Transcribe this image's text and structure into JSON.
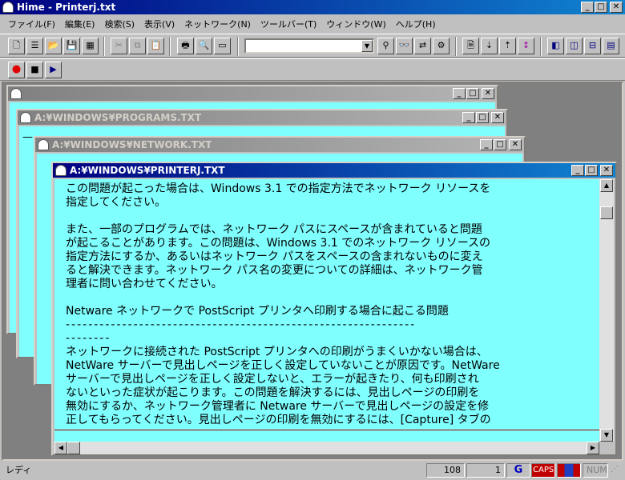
{
  "app": {
    "title": "Hime - Printerj.txt"
  },
  "menu": [
    "ファイル(F)",
    "編集(E)",
    "検索(S)",
    "表示(V)",
    "ネットワーク(N)",
    "ツールバー(T)",
    "ウィンドウ(W)",
    "ヘルプ(H)"
  ],
  "toolbar": {
    "new": "🗋",
    "open_list": "☰",
    "open": "📂",
    "save": "💾",
    "save_all": "▦",
    "cut": "✂",
    "copy": "⧉",
    "paste": "📋",
    "print": "🖶",
    "preview": "🔍",
    "page_setup": "▭",
    "search_value": "",
    "dropdown_arrow": "▼",
    "find": "⚲",
    "find_next": "👓",
    "replace": "⇄",
    "replace_all": "⚙",
    "doc1": "🗎",
    "doc2": "⇣",
    "doc3": "⇡",
    "doc4": "↕",
    "cascade": "◧",
    "tile_v": "◫",
    "tile_h": "⊟",
    "arrange": "▤"
  },
  "macro": {
    "record": "●",
    "stop": "■",
    "play": "▶"
  },
  "windows": {
    "back": {
      "title": ""
    },
    "programs": {
      "title": "A:¥WINDOWS¥PROGRAMS.TXT"
    },
    "network": {
      "title": "A:¥WINDOWS¥NETWORK.TXT"
    },
    "printer": {
      "title": "A:¥WINDOWS¥PRINTERJ.TXT"
    }
  },
  "win_buttons": {
    "minimize": "_",
    "maximize": "□",
    "close": "✕"
  },
  "document": {
    "lines": [
      "この問題が起こった場合は、Windows 3.1 での指定方法でネットワーク リソースを",
      "指定してください。",
      "",
      "また、一部のプログラムでは、ネットワーク パスにスペースが含まれていると問題",
      "が起こることがあります。この問題は、Windows 3.1 でのネットワーク リソースの",
      "指定方法にするか、あるいはネットワーク パスをスペースの含まれないものに変え",
      "ると解決できます。ネットワーク パス名の変更についての詳細は、ネットワーク管",
      "理者に問い合わせてください。",
      "",
      "Netware ネットワークで PostScript プリンタへ印刷する場合に起こる問題",
      "--------------------------------------------------------------",
      "--------",
      "ネットワークに接続された PostScript プリンタへの印刷がうまくいかない場合は、",
      "NetWare サーバーで見出しページを正しく設定していないことが原因です。NetWare",
      "サーバーで見出しページを正しく設定しないと、エラーが起きたり、何も印刷され",
      "ないといった症状が起こります。この問題を解決するには、見出しページの印刷を",
      "無効にするか、ネットワーク管理者に Netware サーバーで見出しページの設定を修",
      "正してもらってください。見出しページの印刷を無効にするには、[Capture] タブの"
    ]
  },
  "status": {
    "mode": "レディ",
    "line": "108",
    "col": "1",
    "g": "G",
    "caps": "CAPS",
    "num": "NUM"
  },
  "colors": {
    "doc_bg": "#80ffff",
    "active_title": "#000080",
    "caps_bg": "#c00000"
  }
}
